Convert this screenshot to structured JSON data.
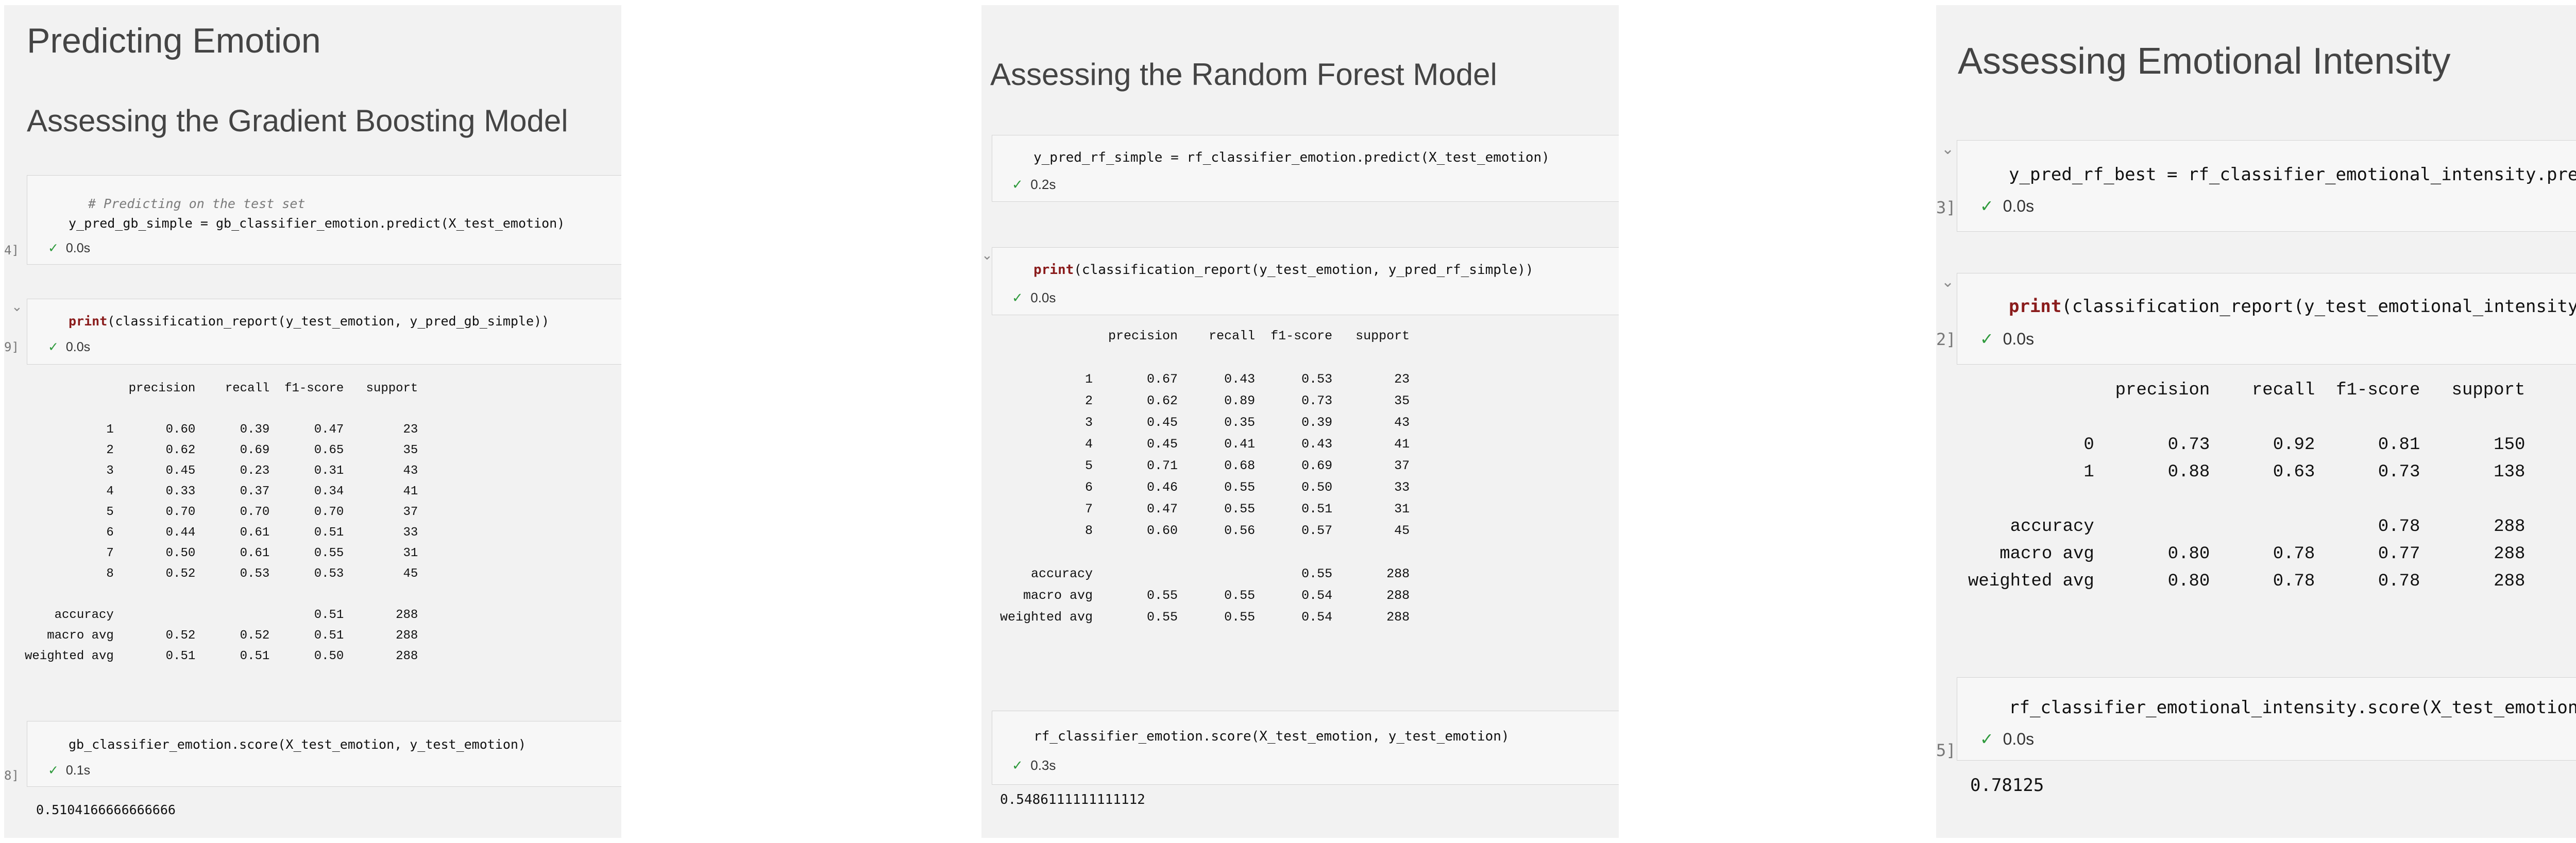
{
  "panel1": {
    "title": "Predicting Emotion",
    "subtitle": "Assessing the Gradient Boosting Model",
    "cell1": {
      "comment": "# Predicting on the test set",
      "code": "y_pred_gb_simple = gb_classifier_emotion.predict(X_test_emotion)",
      "exec": "4]",
      "time": "0.0s"
    },
    "cell2": {
      "kw": "print",
      "code": "(classification_report(y_test_emotion, y_pred_gb_simple))",
      "exec": "9]",
      "time": "0.0s"
    },
    "report": "              precision    recall  f1-score   support\n\n           1       0.60      0.39      0.47        23\n           2       0.62      0.69      0.65        35\n           3       0.45      0.23      0.31        43\n           4       0.33      0.37      0.34        41\n           5       0.70      0.70      0.70        37\n           6       0.44      0.61      0.51        33\n           7       0.50      0.61      0.55        31\n           8       0.52      0.53      0.53        45\n\n    accuracy                           0.51       288\n   macro avg       0.52      0.52      0.51       288\nweighted avg       0.51      0.51      0.50       288",
    "cell3": {
      "code": "gb_classifier_emotion.score(X_test_emotion, y_test_emotion)",
      "exec": "8]",
      "time": "0.1s"
    },
    "result": "0.5104166666666666"
  },
  "panel2": {
    "subtitle": "Assessing the Random Forest Model",
    "cell1": {
      "code": "y_pred_rf_simple = rf_classifier_emotion.predict(X_test_emotion)",
      "time": "0.2s"
    },
    "cell2": {
      "kw": "print",
      "code": "(classification_report(y_test_emotion, y_pred_rf_simple))",
      "time": "0.0s"
    },
    "report": "              precision    recall  f1-score   support\n\n           1       0.67      0.43      0.53        23\n           2       0.62      0.89      0.73        35\n           3       0.45      0.35      0.39        43\n           4       0.45      0.41      0.43        41\n           5       0.71      0.68      0.69        37\n           6       0.46      0.55      0.50        33\n           7       0.47      0.55      0.51        31\n           8       0.60      0.56      0.57        45\n\n    accuracy                           0.55       288\n   macro avg       0.55      0.55      0.54       288\nweighted avg       0.55      0.55      0.54       288",
    "cell3": {
      "code": "rf_classifier_emotion.score(X_test_emotion, y_test_emotion)",
      "time": "0.3s"
    },
    "result": "0.5486111111111112"
  },
  "panel3": {
    "subtitle": "Assessing Emotional Intensity",
    "cell1": {
      "code": "y_pred_rf_best = rf_classifier_emotional_intensity.predict",
      "exec": "3]",
      "time": "0.0s"
    },
    "cell2": {
      "kw": "print",
      "code": "(classification_report(y_test_emotional_intensity, y",
      "exec": "2]",
      "time": "0.0s"
    },
    "report": "              precision    recall  f1-score   support\n\n           0       0.73      0.92      0.81       150\n           1       0.88      0.63      0.73       138\n\n    accuracy                           0.78       288\n   macro avg       0.80      0.78      0.77       288\nweighted avg       0.80      0.78      0.78       288",
    "cell3": {
      "code": "rf_classifier_emotional_intensity.score(X_test_emotional_",
      "exec": "5]",
      "time": "0.0s"
    },
    "result": "0.78125"
  },
  "icons": {
    "check": "check-icon",
    "chevron": "chevron-down-icon"
  },
  "colors": {
    "check": "#2e9a3c",
    "keyword": "#8a1c1c",
    "panel_bg": "#f2f2f2"
  }
}
